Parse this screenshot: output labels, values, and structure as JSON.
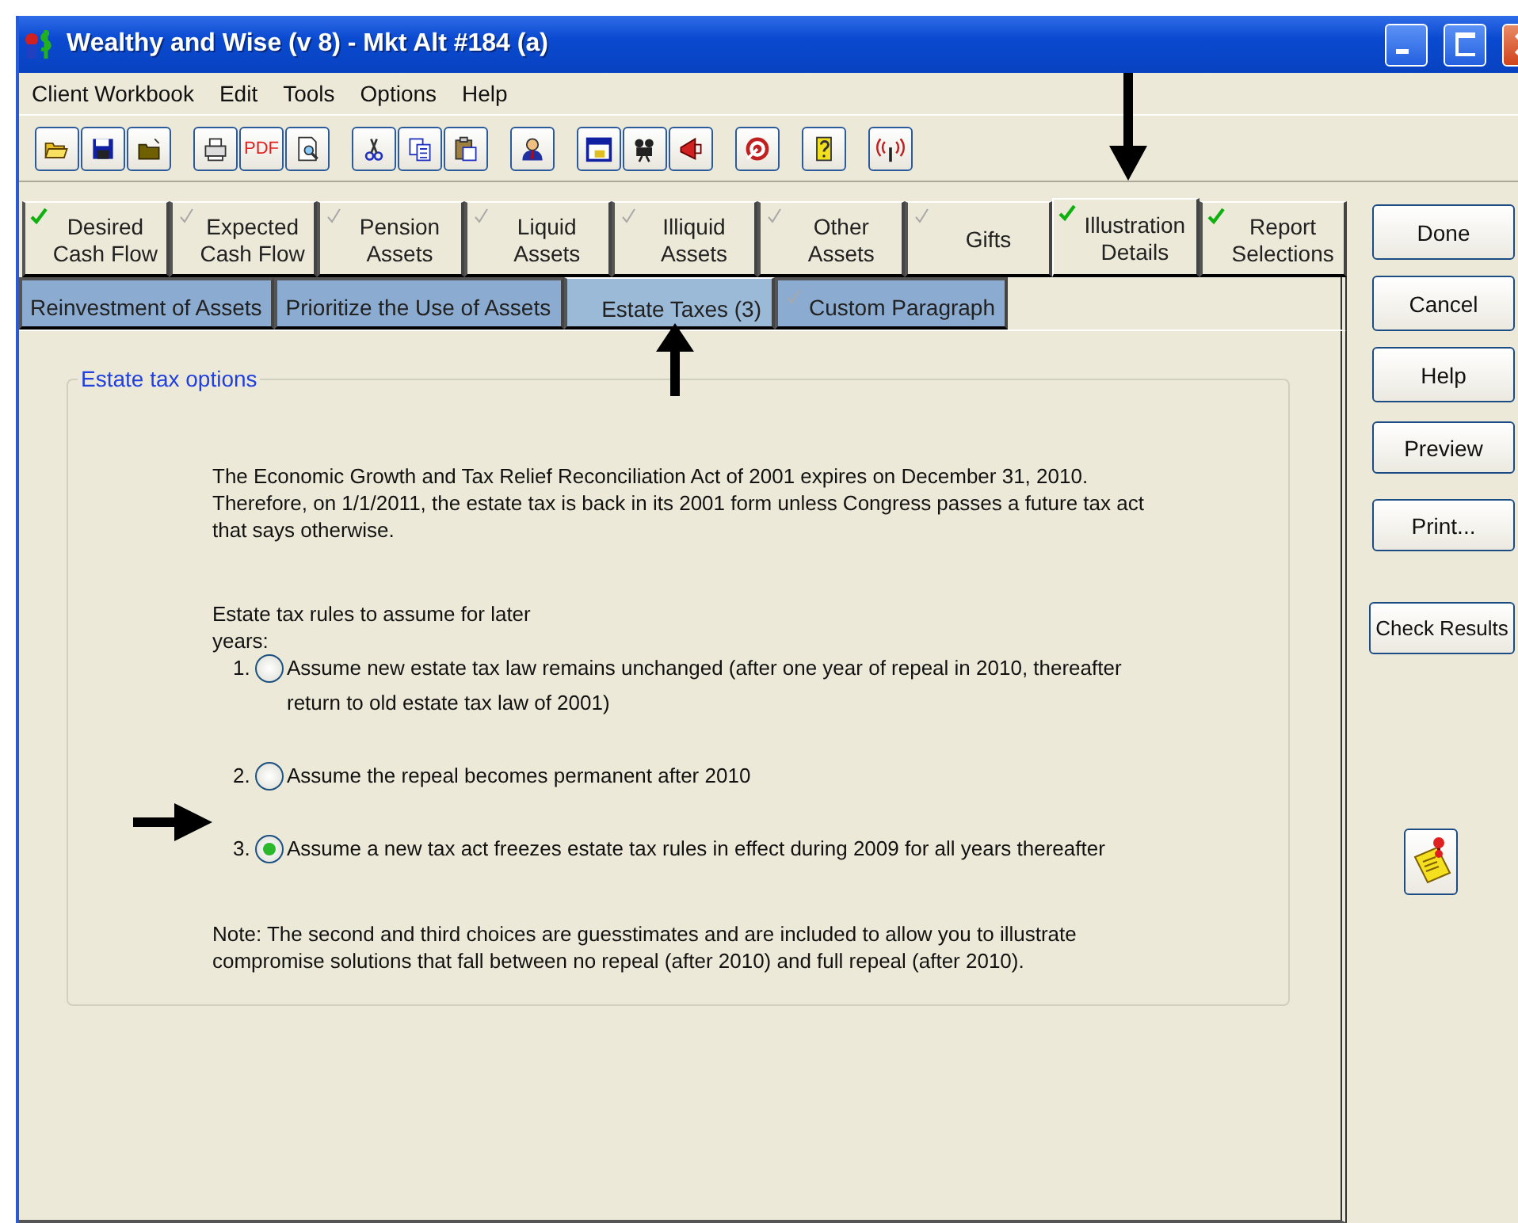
{
  "window": {
    "title": "Wealthy and Wise (v 8) - Mkt Alt #184 (a)"
  },
  "menu": [
    "Client Workbook",
    "Edit",
    "Tools",
    "Options",
    "Help"
  ],
  "toolbar": [
    [
      {
        "kind": "open"
      },
      {
        "kind": "save"
      },
      {
        "kind": "folder"
      }
    ],
    [
      {
        "kind": "print"
      },
      {
        "kind": "pdf",
        "label": "PDF"
      },
      {
        "kind": "preview"
      }
    ],
    [
      {
        "kind": "cut"
      },
      {
        "kind": "copy"
      },
      {
        "kind": "paste"
      }
    ],
    [
      {
        "kind": "person"
      }
    ],
    [
      {
        "kind": "calendar"
      },
      {
        "kind": "camera"
      },
      {
        "kind": "megaphone"
      }
    ],
    [
      {
        "kind": "target"
      }
    ],
    [
      {
        "kind": "help"
      }
    ],
    [
      {
        "kind": "signal"
      }
    ]
  ],
  "tabs": [
    {
      "label": "Desired\nCash Flow",
      "complete": true,
      "selected": false
    },
    {
      "label": "Expected\nCash Flow",
      "complete": false,
      "selected": false
    },
    {
      "label": "Pension\nAssets",
      "complete": false,
      "selected": false
    },
    {
      "label": "Liquid\nAssets",
      "complete": false,
      "selected": false
    },
    {
      "label": "Illiquid\nAssets",
      "complete": false,
      "selected": false
    },
    {
      "label": "Other\nAssets",
      "complete": false,
      "selected": false
    },
    {
      "label": "Gifts",
      "complete": false,
      "selected": false
    },
    {
      "label": "Illustration\nDetails",
      "complete": true,
      "selected": true
    },
    {
      "label": "Report\nSelections",
      "complete": true,
      "selected": false
    }
  ],
  "subtabs": [
    {
      "label": "Reinvestment of Assets",
      "kind": "plain",
      "selected": false
    },
    {
      "label": "Prioritize the Use of Assets",
      "kind": "plain",
      "selected": false
    },
    {
      "label": "Estate Taxes (3)",
      "kind": "plain",
      "selected": true
    },
    {
      "label": "Custom Paragraph",
      "kind": "checklist",
      "complete": false,
      "selected": false
    }
  ],
  "group": {
    "title": "Estate tax options",
    "intro": "The Economic Growth and Tax Relief Reconciliation Act of 2001 expires on December 31, 2010. Therefore, on 1/1/2011, the estate tax is back in its 2001 form unless Congress passes a future tax act that says otherwise.",
    "question": "Estate tax rules to assume for later years:",
    "options": [
      {
        "number": "1.",
        "label": "Assume new estate tax law remains unchanged (after one year of repeal in 2010, thereafter return to old estate tax law of 2001)",
        "selected": false
      },
      {
        "number": "2.",
        "label": "Assume the repeal becomes permanent after 2010",
        "selected": false
      },
      {
        "number": "3.",
        "label": "Assume a new tax act freezes estate tax rules in effect during 2009 for all years thereafter",
        "selected": true
      }
    ],
    "note": "Note:  The second and third choices are guesstimates and are included to allow you to illustrate compromise solutions that fall between no repeal (after 2010) and full repeal (after 2010)."
  },
  "side_buttons": [
    {
      "label": "Done",
      "kind": "normal"
    },
    {
      "label": "Cancel",
      "kind": "normal"
    },
    {
      "label": "Help",
      "kind": "normal"
    },
    {
      "label": "Preview",
      "kind": "spaced"
    },
    {
      "label": "Print...",
      "kind": "spaced"
    },
    {
      "label": "Check Results",
      "kind": "wide"
    }
  ]
}
